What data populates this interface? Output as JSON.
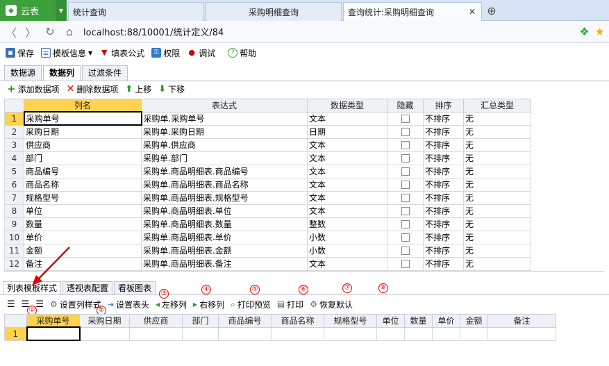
{
  "tabbar": {
    "app_name": "云表",
    "tabs": [
      {
        "label": "统计查询"
      },
      {
        "label": "采购明细查询"
      },
      {
        "label": "查询统计:采购明细查询"
      }
    ],
    "close_symbol": "✕",
    "new_tab_symbol": "⊕"
  },
  "address": {
    "url": "localhost:88/10001/统计定义/84",
    "icons": [
      "back-icon",
      "forward-icon",
      "reload-icon",
      "home-icon"
    ]
  },
  "toolbar": {
    "items": [
      {
        "label": "保存",
        "icon": "save-icon"
      },
      {
        "label": "模板信息",
        "icon": "template-icon"
      },
      {
        "label": "填表公式",
        "icon": "formula-icon"
      },
      {
        "label": "权限",
        "icon": "permission-icon"
      },
      {
        "label": "调试",
        "icon": "debug-icon"
      },
      {
        "label": "帮助",
        "icon": "help-icon"
      }
    ]
  },
  "section_tabs": [
    {
      "label": "数据源"
    },
    {
      "label": "数据列"
    },
    {
      "label": "过滤条件"
    }
  ],
  "actions": [
    {
      "label": "添加数据项",
      "icon": "plus-icon"
    },
    {
      "label": "删除数据项",
      "icon": "delete-icon"
    },
    {
      "label": "上移",
      "icon": "arrow-up-icon"
    },
    {
      "label": "下移",
      "icon": "arrow-down-icon"
    }
  ],
  "columns_grid": {
    "headers": [
      "列名",
      "表达式",
      "数据类型",
      "隐藏",
      "排序",
      "汇总类型"
    ],
    "rows": [
      {
        "n": "1",
        "name": "采购单号",
        "expr": "采购单.采购单号",
        "type": "文本",
        "sort": "不排序",
        "agg": "无"
      },
      {
        "n": "2",
        "name": "采购日期",
        "expr": "采购单.采购日期",
        "type": "日期",
        "sort": "不排序",
        "agg": "无"
      },
      {
        "n": "3",
        "name": "供应商",
        "expr": "采购单.供应商",
        "type": "文本",
        "sort": "不排序",
        "agg": "无"
      },
      {
        "n": "4",
        "name": "部门",
        "expr": "采购单.部门",
        "type": "文本",
        "sort": "不排序",
        "agg": "无"
      },
      {
        "n": "5",
        "name": "商品编号",
        "expr": "采购单.商品明细表.商品编号",
        "type": "文本",
        "sort": "不排序",
        "agg": "无"
      },
      {
        "n": "6",
        "name": "商品名称",
        "expr": "采购单.商品明细表.商品名称",
        "type": "文本",
        "sort": "不排序",
        "agg": "无"
      },
      {
        "n": "7",
        "name": "规格型号",
        "expr": "采购单.商品明细表.规格型号",
        "type": "文本",
        "sort": "不排序",
        "agg": "无"
      },
      {
        "n": "8",
        "name": "单位",
        "expr": "采购单.商品明细表.单位",
        "type": "文本",
        "sort": "不排序",
        "agg": "无"
      },
      {
        "n": "9",
        "name": "数量",
        "expr": "采购单.商品明细表.数量",
        "type": "整数",
        "sort": "不排序",
        "agg": "无"
      },
      {
        "n": "10",
        "name": "单价",
        "expr": "采购单.商品明细表.单价",
        "type": "小数",
        "sort": "不排序",
        "agg": "无"
      },
      {
        "n": "11",
        "name": "金额",
        "expr": "采购单.商品明细表.金额",
        "type": "小数",
        "sort": "不排序",
        "agg": "无"
      },
      {
        "n": "12",
        "name": "备注",
        "expr": "采购单.商品明细表.备注",
        "type": "文本",
        "sort": "不排序",
        "agg": "无"
      }
    ]
  },
  "lower_tabs": [
    {
      "label": "列表模板样式"
    },
    {
      "label": "透视表配置"
    },
    {
      "label": "看板图表"
    }
  ],
  "lower_tools": [
    {
      "label": "设置列样式",
      "icon": "gear-icon"
    },
    {
      "label": "设置表头",
      "icon": "header-icon"
    },
    {
      "label": "左移列",
      "icon": "arrow-left-icon"
    },
    {
      "label": "右移列",
      "icon": "arrow-right-icon"
    },
    {
      "label": "打印预览",
      "icon": "print-preview-icon"
    },
    {
      "label": "打印",
      "icon": "print-icon"
    },
    {
      "label": "恢复默认",
      "icon": "restore-icon"
    }
  ],
  "markers": [
    "①",
    "②",
    "③",
    "④",
    "⑤",
    "⑥",
    "⑦",
    "⑧"
  ],
  "preview_grid": {
    "headers": [
      "采购单号",
      "采购日期",
      "供应商",
      "部门",
      "商品编号",
      "商品名称",
      "规格型号",
      "单位",
      "数量",
      "单价",
      "金额",
      "备注"
    ],
    "row_number": "1"
  },
  "colors": {
    "app_green": "#3ca13c",
    "selected_header": "#ffd34e",
    "annotation_red": "#e00000"
  }
}
